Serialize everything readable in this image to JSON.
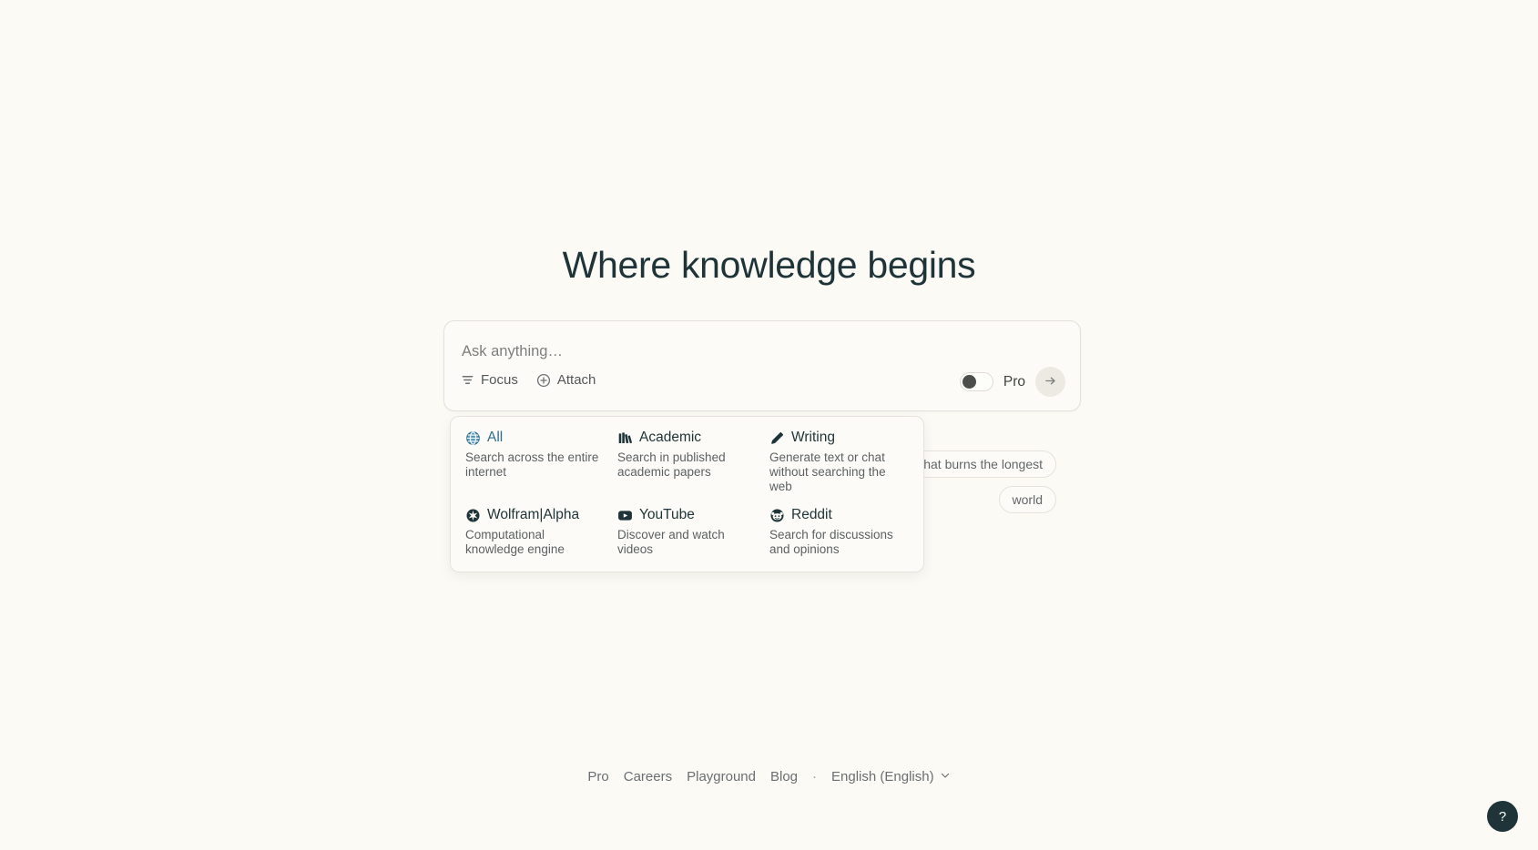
{
  "hero": {
    "title": "Where knowledge begins"
  },
  "search": {
    "placeholder": "Ask anything…",
    "focus_label": "Focus",
    "attach_label": "Attach",
    "pro_label": "Pro",
    "pro_enabled": false,
    "submit_icon": "arrow-right-icon"
  },
  "suggestions": [
    {
      "text": "that burns the longest"
    },
    {
      "text": "world"
    }
  ],
  "focus_menu": {
    "items": [
      {
        "name": "All",
        "desc": "Search across the entire internet",
        "icon": "globe-icon",
        "active": true
      },
      {
        "name": "Academic",
        "desc": "Search in published academic papers",
        "icon": "library-icon",
        "active": false
      },
      {
        "name": "Writing",
        "desc": "Generate text or chat without searching the web",
        "icon": "pencil-icon",
        "active": false
      },
      {
        "name": "Wolfram|Alpha",
        "desc": "Computational knowledge engine",
        "icon": "wolfram-icon",
        "active": false
      },
      {
        "name": "YouTube",
        "desc": "Discover and watch videos",
        "icon": "youtube-icon",
        "active": false
      },
      {
        "name": "Reddit",
        "desc": "Search for discussions and opinions",
        "icon": "reddit-icon",
        "active": false
      }
    ]
  },
  "footer": {
    "links": [
      "Pro",
      "Careers",
      "Playground",
      "Blog"
    ],
    "separator": "·",
    "language": "English (English)",
    "help_label": "?"
  },
  "colors": {
    "background": "#fbfaf5",
    "text_primary": "#1f3438",
    "text_secondary": "#5d6164",
    "accent_blue": "#2e6f8e",
    "border": "#e3e1d9"
  }
}
